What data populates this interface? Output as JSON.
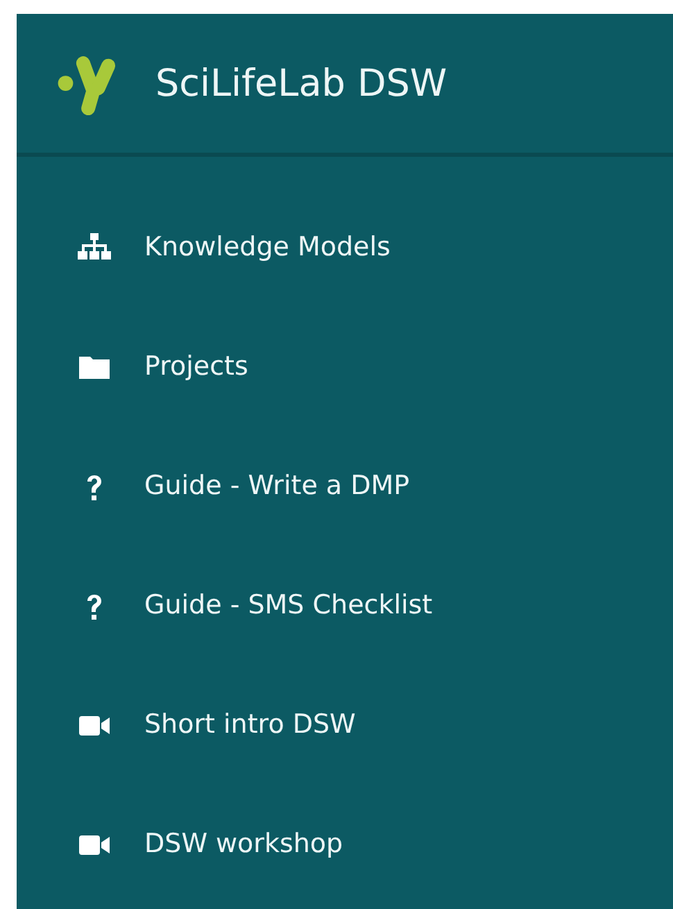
{
  "brand": {
    "title": "SciLifeLab DSW"
  },
  "menu": [
    {
      "label": "Knowledge Models",
      "kind": "sitemap"
    },
    {
      "label": "Projects",
      "kind": "folder"
    },
    {
      "label": "Guide - Write a DMP",
      "kind": "question"
    },
    {
      "label": "Guide - SMS Checklist",
      "kind": "question"
    },
    {
      "label": "Short intro DSW",
      "kind": "video"
    },
    {
      "label": "DSW workshop",
      "kind": "video"
    }
  ]
}
